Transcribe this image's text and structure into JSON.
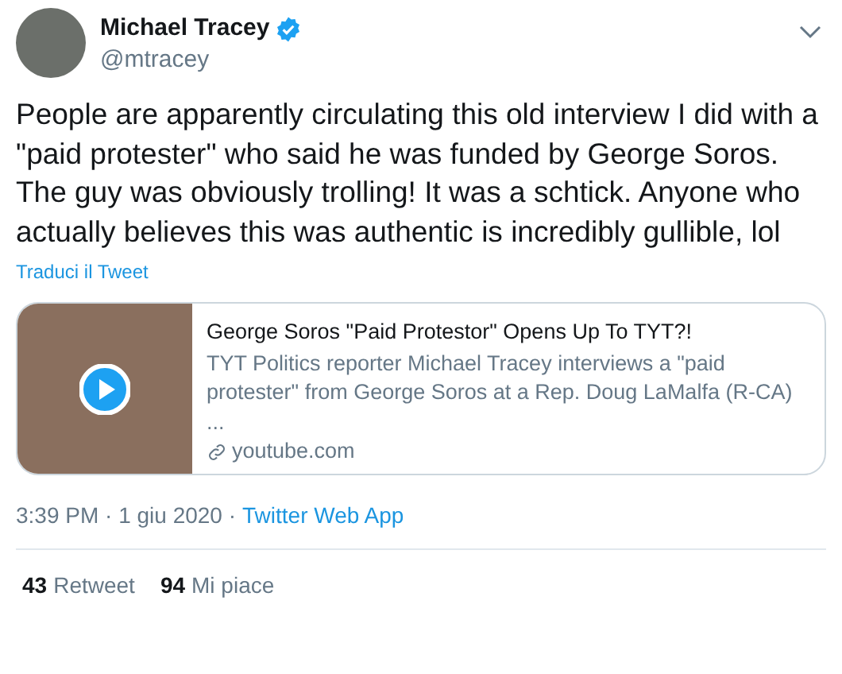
{
  "author": {
    "name": "Michael Tracey",
    "verified": true,
    "handle": "@mtracey"
  },
  "tweet_text": "People are apparently circulating this old interview I did with a \"paid protester\" who said he was funded by George Soros. The guy was obviously trolling! It was a schtick. Anyone who actually believes this was authentic is incredibly gullible, lol",
  "translate_link": "Traduci il Tweet",
  "link_card": {
    "title": "George Soros \"Paid Protestor\" Opens Up To TYT?!",
    "description": "TYT Politics reporter Michael Tracey interviews a \"paid protester\" from George Soros at a Rep. Doug LaMalfa (R-CA) ...",
    "domain": "youtube.com"
  },
  "timestamp": "3:39 PM · 1 giu 2020 ·",
  "source": "Twitter Web App",
  "stats": [
    {
      "count": "43",
      "label": "Retweet"
    },
    {
      "count": "94",
      "label": "Mi piace"
    }
  ]
}
